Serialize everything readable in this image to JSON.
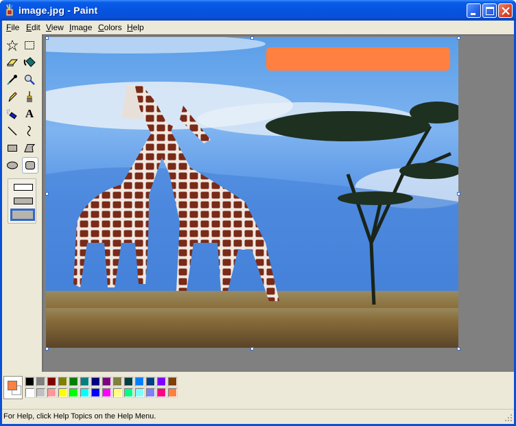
{
  "window": {
    "title": "image.jpg - Paint",
    "controls": [
      "minimize",
      "maximize",
      "close"
    ]
  },
  "menubar": {
    "items": [
      {
        "label": "File",
        "accel": "F"
      },
      {
        "label": "Edit",
        "accel": "E"
      },
      {
        "label": "View",
        "accel": "V"
      },
      {
        "label": "Image",
        "accel": "I"
      },
      {
        "label": "Colors",
        "accel": "C"
      },
      {
        "label": "Help",
        "accel": "H"
      }
    ]
  },
  "toolbox": {
    "tools": [
      {
        "name": "free-form-select",
        "icon": "free-select-icon"
      },
      {
        "name": "select",
        "icon": "rect-select-icon"
      },
      {
        "name": "eraser",
        "icon": "eraser-icon"
      },
      {
        "name": "fill-with-color",
        "icon": "paint-bucket-icon"
      },
      {
        "name": "pick-color",
        "icon": "eyedropper-icon"
      },
      {
        "name": "magnifier",
        "icon": "magnifier-icon"
      },
      {
        "name": "pencil",
        "icon": "pencil-icon"
      },
      {
        "name": "brush",
        "icon": "brush-icon"
      },
      {
        "name": "airbrush",
        "icon": "airbrush-icon"
      },
      {
        "name": "text",
        "icon": "text-icon"
      },
      {
        "name": "line",
        "icon": "line-icon"
      },
      {
        "name": "curve",
        "icon": "curve-icon"
      },
      {
        "name": "rectangle",
        "icon": "rectangle-icon"
      },
      {
        "name": "polygon",
        "icon": "polygon-icon"
      },
      {
        "name": "ellipse",
        "icon": "ellipse-icon"
      },
      {
        "name": "rounded-rectangle",
        "icon": "rounded-rectangle-icon",
        "selected": true
      }
    ],
    "fill_options": [
      "outline",
      "outline-and-fill",
      "fill-only"
    ],
    "selected_fill_option": "fill-only",
    "text_glyph": "A"
  },
  "canvas": {
    "image_description": "Two giraffes beside an acacia tree under a blue sky",
    "drawn_shape": {
      "type": "rounded-rectangle",
      "color": "#ff8040"
    }
  },
  "colors": {
    "foreground": "#ff8040",
    "background": "#ffffff",
    "palette_top": [
      "#000000",
      "#808080",
      "#800000",
      "#808000",
      "#008000",
      "#008080",
      "#000080",
      "#800080",
      "#808040",
      "#004040",
      "#0080ff",
      "#004080",
      "#8000ff",
      "#804000"
    ],
    "palette_bottom": [
      "#ffffff",
      "#c0c0c0",
      "#ff9999",
      "#ffff00",
      "#00ff00",
      "#00ffff",
      "#0000ff",
      "#ff00ff",
      "#ffff80",
      "#00ff80",
      "#80ffff",
      "#8080ff",
      "#ff0080",
      "#ff8040"
    ]
  },
  "statusbar": {
    "text": "For Help, click Help Topics on the Help Menu."
  }
}
